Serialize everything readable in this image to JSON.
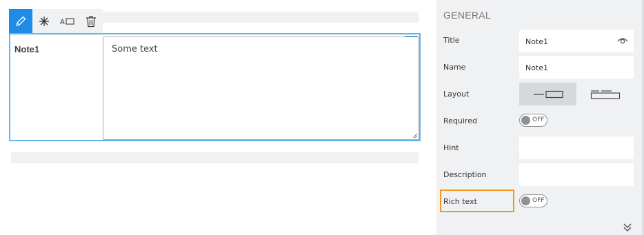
{
  "toolbar": {
    "icons": [
      "pencil-icon",
      "asterisk-icon",
      "label-box-icon",
      "trash-icon"
    ],
    "label_box_text": "A",
    "active_color": "#1e8ce6"
  },
  "field": {
    "label": "Note1",
    "value": "Some text",
    "resize_handle": "↔",
    "accent": "#63b3ec"
  },
  "panel": {
    "section_title": "GENERAL",
    "title_label": "Title",
    "title_value": "Note1",
    "name_label": "Name",
    "name_value": "Note1",
    "layout_label": "Layout",
    "required_label": "Required",
    "required_toggle": "OFF",
    "hint_label": "Hint",
    "hint_value": "",
    "description_label": "Description",
    "description_value": "",
    "rich_text_label": "Rich text",
    "rich_text_toggle": "OFF",
    "highlight_color": "#f3961f",
    "more_icon": "double-chevron-down-icon"
  }
}
